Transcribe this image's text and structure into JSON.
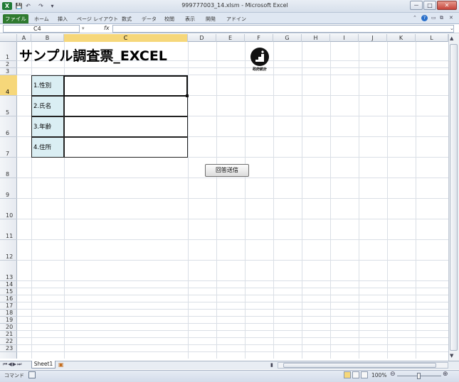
{
  "window": {
    "title": "999777003_14.xlsm  -  Microsoft Excel",
    "controls": {
      "minimize": "－",
      "maximize": "□",
      "close": "✕"
    }
  },
  "quick_access": {
    "save_icon": "💾",
    "undo_icon": "↶",
    "redo_icon": "↷",
    "dropdown": "▾"
  },
  "ribbon": {
    "file_tab": "ファイル",
    "tabs": [
      "ホーム",
      "挿入",
      "ページ レイアウト",
      "数式",
      "データ",
      "校閲",
      "表示",
      "開発",
      "アドイン"
    ]
  },
  "formula_bar": {
    "name_box": "C4",
    "fx": "fx",
    "value": ""
  },
  "columns": [
    "A",
    "B",
    "C",
    "D",
    "E",
    "F",
    "G",
    "H",
    "I",
    "J",
    "K",
    "L"
  ],
  "rows": [
    "1",
    "2",
    "3",
    "4",
    "5",
    "6",
    "7",
    "8",
    "9",
    "10",
    "11",
    "12",
    "13",
    "14",
    "15",
    "16",
    "17",
    "18",
    "19",
    "20",
    "21",
    "22",
    "23"
  ],
  "sheet": {
    "title": "サンプル調査票_EXCEL",
    "logo_text": "政府統計",
    "fields": [
      {
        "label": "1.性別",
        "value": ""
      },
      {
        "label": "2.氏名",
        "value": ""
      },
      {
        "label": "3.年齢",
        "value": ""
      },
      {
        "label": "4.住所",
        "value": ""
      }
    ],
    "submit_label": "回答送信"
  },
  "sheet_tabs": [
    "Sheet1"
  ],
  "status": {
    "mode": "コマンド",
    "zoom": "100%"
  },
  "colors": {
    "file_tab": "#2f7a2f",
    "label_fill": "#daeef3",
    "selected_header": "#f6d77a"
  }
}
